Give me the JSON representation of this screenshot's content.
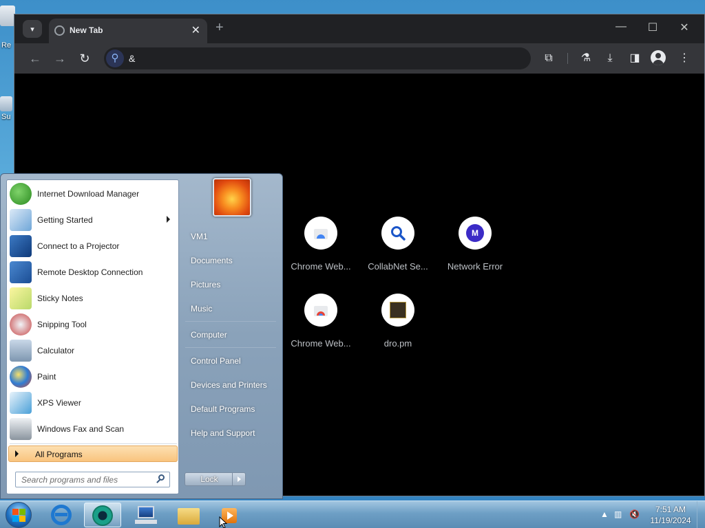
{
  "desktop": {
    "peek_texts": [
      "Re",
      "Su"
    ]
  },
  "browser": {
    "tab_menu_icon": "chevron-down-icon",
    "tab_title": "New Tab",
    "tab_close": "✕",
    "new_tab": "+",
    "window_controls": {
      "minimize": "—",
      "maximize": "☐",
      "close": "✕"
    },
    "nav": {
      "back": "←",
      "forward": "→",
      "reload": "↻"
    },
    "omnibox": {
      "value": "&"
    },
    "shortcuts": [
      {
        "label": "Chrome Web...",
        "icon": "chrome-web-store-icon"
      },
      {
        "label": "CollabNet Se...",
        "icon": "search-icon"
      },
      {
        "label": "Network Error",
        "icon": "m-letter-icon",
        "letter": "M"
      },
      {
        "label": "Chrome Web...",
        "icon": "chrome-web-store-icon"
      },
      {
        "label": "dro.pm",
        "icon": "dro-pm-icon"
      }
    ]
  },
  "start_menu": {
    "programs": [
      {
        "label": "Internet Download Manager",
        "icon": "idm-icon"
      },
      {
        "label": "Getting Started",
        "icon": "getting-started-icon",
        "submenu": true
      },
      {
        "label": "Connect to a Projector",
        "icon": "projector-icon"
      },
      {
        "label": "Remote Desktop Connection",
        "icon": "remote-desktop-icon"
      },
      {
        "label": "Sticky Notes",
        "icon": "sticky-notes-icon"
      },
      {
        "label": "Snipping Tool",
        "icon": "snipping-tool-icon"
      },
      {
        "label": "Calculator",
        "icon": "calculator-icon"
      },
      {
        "label": "Paint",
        "icon": "paint-icon"
      },
      {
        "label": "XPS Viewer",
        "icon": "xps-viewer-icon"
      },
      {
        "label": "Windows Fax and Scan",
        "icon": "fax-scan-icon"
      }
    ],
    "all_programs": "All Programs",
    "search_placeholder": "Search programs and files",
    "right_items": [
      "VM1",
      "Documents",
      "Pictures",
      "Music",
      "Computer",
      "Control Panel",
      "Devices and Printers",
      "Default Programs",
      "Help and Support"
    ],
    "lock_label": "Lock"
  },
  "taskbar": {
    "items": [
      "ie-icon",
      "chrome-icon",
      "network-computer-icon",
      "explorer-icon",
      "media-player-icon"
    ],
    "clock_time": "7:51 AM",
    "clock_date": "11/19/2024"
  },
  "colors": {
    "idm_green": "#3a9b2c",
    "start_hover": "#f9c47e",
    "chrome_dark": "#202124"
  }
}
